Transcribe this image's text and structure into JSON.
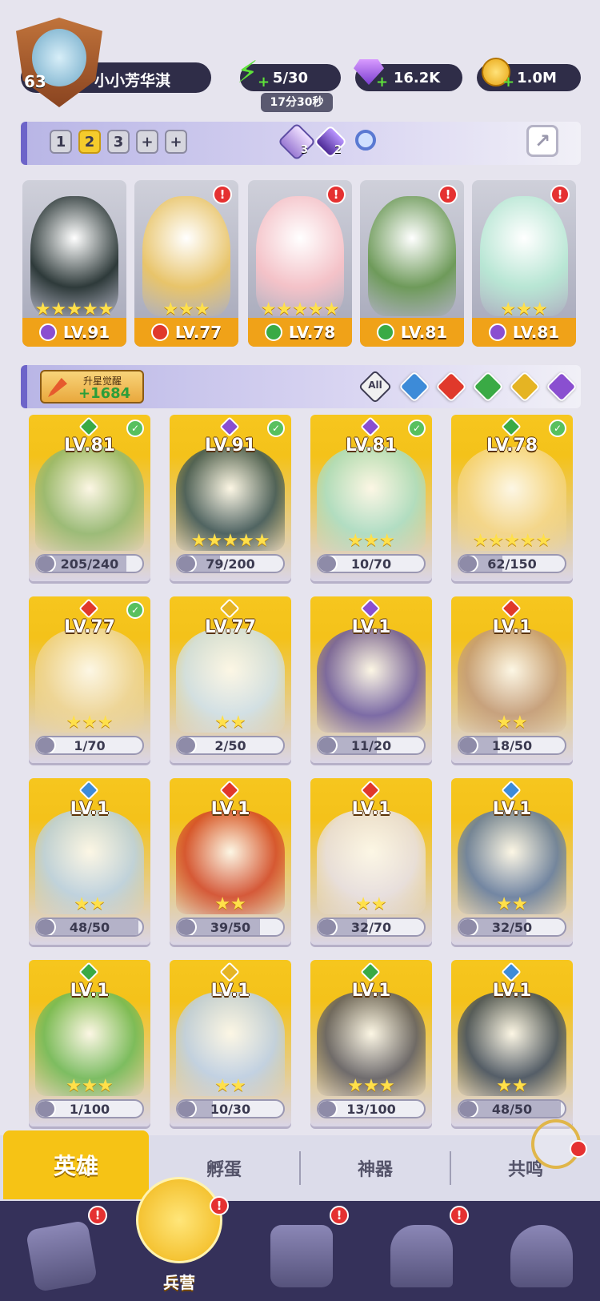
{
  "player": {
    "level": "63",
    "name": "小小芳华淇"
  },
  "resources": {
    "energy": "5/30",
    "energy_timer": "17分30秒",
    "gems": "16.2K",
    "gold": "1.0M"
  },
  "team_tabs": [
    "1",
    "2",
    "3"
  ],
  "active_team_tab": "2",
  "essence": {
    "purple_count": "3",
    "dark_count": "2"
  },
  "team_heroes": [
    {
      "level": "LV.91",
      "stars": 5,
      "element": "dark",
      "alert": false,
      "art": "#2e3a3a"
    },
    {
      "level": "LV.77",
      "stars": 3,
      "element": "fire",
      "alert": true,
      "art": "#e8c46a"
    },
    {
      "level": "LV.78",
      "stars": 5,
      "element": "earth",
      "alert": true,
      "art": "#f4c2c8"
    },
    {
      "level": "LV.81",
      "stars": 0,
      "element": "earth",
      "alert": true,
      "art": "#6e9a5a"
    },
    {
      "level": "LV.81",
      "stars": 3,
      "element": "dark",
      "alert": true,
      "art": "#b8e6d4"
    }
  ],
  "upgrade": {
    "label": "升星觉醒",
    "value": "+1684"
  },
  "filters": {
    "all": "All",
    "colors": [
      "#3d8bd8",
      "#e0392b",
      "#3aaa45",
      "#e5b423",
      "#8a4fd0"
    ]
  },
  "heroes": [
    {
      "level": "LV.81",
      "element": "earth",
      "frag": "205/240",
      "progress": 0.85,
      "stars": 0,
      "checked": true,
      "art": "#8fb873"
    },
    {
      "level": "LV.91",
      "element": "dark",
      "frag": "79/200",
      "progress": 0.4,
      "stars": 5,
      "checked": true,
      "art": "#36525a"
    },
    {
      "level": "LV.81",
      "element": "dark",
      "frag": "10/70",
      "progress": 0.14,
      "stars": 3,
      "checked": true,
      "art": "#a8e0cc"
    },
    {
      "level": "LV.78",
      "element": "earth",
      "frag": "62/150",
      "progress": 0.41,
      "stars": 5,
      "checked": true,
      "art": "#f6d88a"
    },
    {
      "level": "LV.77",
      "element": "fire",
      "frag": "1/70",
      "progress": 0.01,
      "stars": 3,
      "checked": true,
      "art": "#efd79a"
    },
    {
      "level": "LV.77",
      "element": "light",
      "frag": "2/50",
      "progress": 0.04,
      "stars": 2,
      "checked": false,
      "art": "#cfe3f2"
    },
    {
      "level": "LV.1",
      "element": "dark",
      "frag": "11/20",
      "progress": 0.55,
      "stars": 0,
      "checked": false,
      "art": "#6a5aa8"
    },
    {
      "level": "LV.1",
      "element": "fire",
      "frag": "18/50",
      "progress": 0.36,
      "stars": 2,
      "checked": false,
      "art": "#c29a7a"
    },
    {
      "level": "LV.1",
      "element": "water",
      "frag": "48/50",
      "progress": 0.96,
      "stars": 2,
      "checked": false,
      "art": "#b9d3ea"
    },
    {
      "level": "LV.1",
      "element": "fire",
      "frag": "39/50",
      "progress": 0.78,
      "stars": 2,
      "checked": false,
      "art": "#d2452a"
    },
    {
      "level": "LV.1",
      "element": "fire",
      "frag": "32/70",
      "progress": 0.46,
      "stars": 2,
      "checked": false,
      "art": "#e8e2ea"
    },
    {
      "level": "LV.1",
      "element": "water",
      "frag": "32/50",
      "progress": 0.64,
      "stars": 2,
      "checked": false,
      "art": "#5f7aa6"
    },
    {
      "level": "LV.1",
      "element": "earth",
      "frag": "1/100",
      "progress": 0.01,
      "stars": 3,
      "checked": false,
      "art": "#6aba5a"
    },
    {
      "level": "LV.1",
      "element": "light",
      "frag": "10/30",
      "progress": 0.33,
      "stars": 2,
      "checked": false,
      "art": "#bcd2f0"
    },
    {
      "level": "LV.1",
      "element": "earth",
      "frag": "13/100",
      "progress": 0.13,
      "stars": 3,
      "checked": false,
      "art": "#5a5a66"
    },
    {
      "level": "LV.1",
      "element": "water",
      "frag": "48/50",
      "progress": 0.96,
      "stars": 2,
      "checked": false,
      "art": "#3b4a60"
    }
  ],
  "sub_tabs": [
    "英雄",
    "孵蛋",
    "神器",
    "共鸣"
  ],
  "bottom_nav": {
    "active_label": "兵营"
  },
  "element_colors": {
    "dark": "#8a4fd0",
    "fire": "#e0392b",
    "earth": "#3aaa45",
    "water": "#3d8bd8",
    "light": "#e5b423"
  }
}
